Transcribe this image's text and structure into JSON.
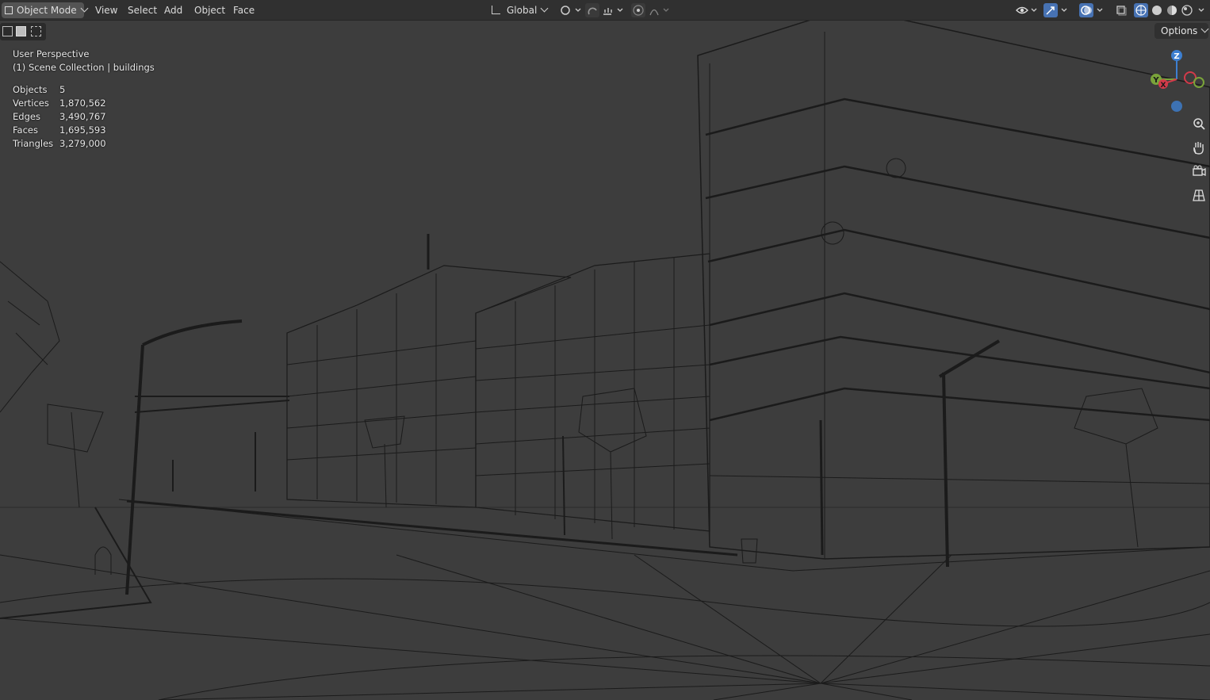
{
  "header": {
    "mode_label": "Object Mode",
    "menus": [
      "View",
      "Select",
      "Add",
      "Object",
      "Face"
    ],
    "transform_orientation": "Global"
  },
  "viewport": {
    "view_name": "User Perspective",
    "collection_info": "(1) Scene Collection | buildings",
    "options_label": "Options",
    "stats": [
      {
        "label": "Objects",
        "value": "5"
      },
      {
        "label": "Vertices",
        "value": "1,870,562"
      },
      {
        "label": "Edges",
        "value": "3,490,767"
      },
      {
        "label": "Faces",
        "value": "1,695,593"
      },
      {
        "label": "Triangles",
        "value": "3,279,000"
      }
    ],
    "gizmo": {
      "z_label": "Z",
      "y_label": "Y",
      "x_label": "X"
    }
  },
  "colors": {
    "header_bg": "#303030",
    "viewport_bg": "#3d3d3d",
    "wire": "#1a1a1a",
    "axis_x": "#d33a4a",
    "axis_y": "#7aa43a",
    "axis_z": "#3d7fd1",
    "accent": "#4772b3"
  },
  "icons": [
    "object-mode-icon",
    "transform-orientation-icon",
    "pivot-icon",
    "snap-icon",
    "snap-increment-icon",
    "proportional-edit-icon",
    "falloff-icon",
    "visibility-icon",
    "gizmo-icon",
    "overlay-icon",
    "xray-icon",
    "wireframe-shading-icon",
    "solid-shading-icon",
    "material-shading-icon",
    "rendered-shading-icon",
    "zoom-icon",
    "hand-icon",
    "camera-icon",
    "grid-icon"
  ]
}
